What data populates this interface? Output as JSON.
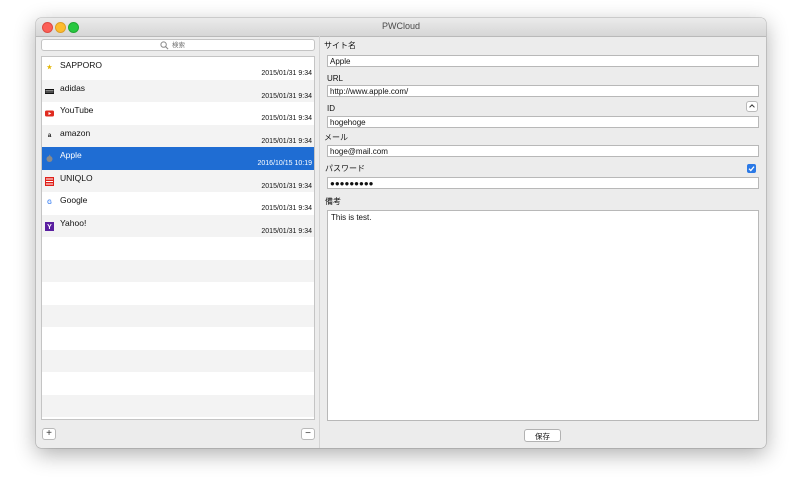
{
  "window": {
    "title": "PWCloud"
  },
  "search": {
    "placeholder": "検索"
  },
  "list": {
    "items": [
      {
        "name": "SAPPORO",
        "date": "2015/01/31 9:34",
        "icon": "star-icon",
        "icon_color": "#e3b500",
        "glyph": "★"
      },
      {
        "name": "adidas",
        "date": "2015/01/31 9:34",
        "icon": "adidas-logo-icon",
        "icon_color": "#111111",
        "glyph": ""
      },
      {
        "name": "YouTube",
        "date": "2015/01/31 9:34",
        "icon": "youtube-icon",
        "icon_color": "#e02b20",
        "glyph": "▶"
      },
      {
        "name": "amazon",
        "date": "2015/01/31 9:34",
        "icon": "amazon-icon",
        "icon_color": "#111111",
        "glyph": "a"
      },
      {
        "name": "Apple",
        "date": "2016/10/15 10:19",
        "icon": "apple-icon",
        "icon_color": "#8a8a8a",
        "glyph": ""
      },
      {
        "name": "UNIQLO",
        "date": "2015/01/31 9:34",
        "icon": "uniqlo-icon",
        "icon_color": "#e0201a",
        "glyph": ""
      },
      {
        "name": "Google",
        "date": "2015/01/31 9:34",
        "icon": "google-icon",
        "icon_color": "#4285f4",
        "glyph": "G"
      },
      {
        "name": "Yahoo!",
        "date": "2015/01/31 9:34",
        "icon": "yahoo-icon",
        "icon_color": "#5a1fa0",
        "glyph": "Y"
      }
    ],
    "selected_index": 4,
    "selected_color": "#1f6dd3"
  },
  "buttons": {
    "add": "+",
    "remove": "−",
    "save": "保存"
  },
  "form": {
    "site_name_label": "サイト名",
    "site_name_value": "Apple",
    "url_label": "URL",
    "url_value": "http://www.apple.com/",
    "id_label": "ID",
    "id_value": "hogehoge",
    "email_label": "メール",
    "email_value": "hoge@mail.com",
    "password_label": "パスワード",
    "password_value": "●●●●●●●●●",
    "password_visible_checked": true,
    "notes_label": "備考",
    "notes_value": "This is test."
  }
}
